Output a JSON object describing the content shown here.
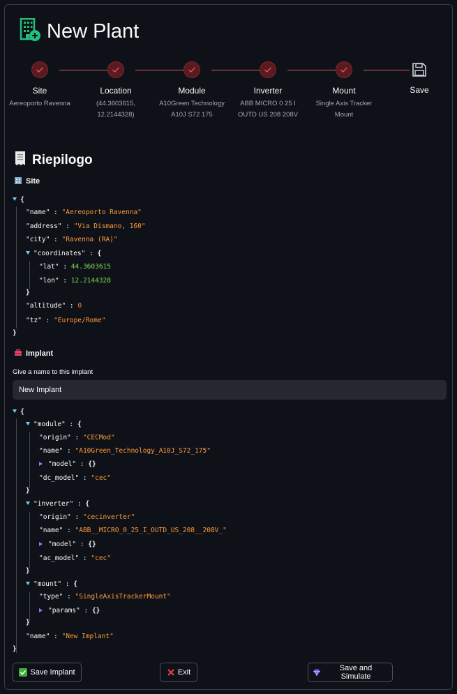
{
  "page": {
    "title": "New Plant",
    "title_icon": "building-plus-icon"
  },
  "stepper": {
    "steps": [
      {
        "label": "Site",
        "sub": "Aereoporto Ravenna",
        "state": "done"
      },
      {
        "label": "Location",
        "sub": "(44.3603615, 12.2144328)",
        "state": "done"
      },
      {
        "label": "Module",
        "sub": "A10Green Technology A10J S72 175",
        "state": "done"
      },
      {
        "label": "Inverter",
        "sub": "ABB MICRO 0 25 I OUTD US 208 208V",
        "state": "done"
      },
      {
        "label": "Mount",
        "sub": "Single Axis Tracker Mount",
        "state": "done"
      },
      {
        "label": "Save",
        "sub": "",
        "state": "current"
      }
    ],
    "done_color": "#e0555f"
  },
  "summary": {
    "heading": "Riepilogo",
    "heading_icon": "receipt-icon",
    "site_heading": "Site",
    "site_icon": "office-building-icon",
    "implant_heading": "Implant",
    "implant_icon": "toolbox-icon"
  },
  "site_json": {
    "name": "\"Aereoporto Ravenna\"",
    "address": "\"Via Dismano, 160\"",
    "city": "\"Ravenna (RA)\"",
    "lat": "44.3603615",
    "lon": "12.2144328",
    "altitude": "0",
    "tz": "\"Europe/Rome\""
  },
  "implant_input": {
    "label": "Give a name to this implant",
    "value": "New Implant"
  },
  "implant_json": {
    "module_origin": "\"CECMod\"",
    "module_name": "\"A10Green_Technology_A10J_S72_175\"",
    "module_dc_model": "\"cec\"",
    "inverter_origin": "\"cecinverter\"",
    "inverter_name": "\"ABB__MICRO_0_25_I_OUTD_US_208__208V_\"",
    "inverter_ac_model": "\"cec\"",
    "mount_type": "\"SingleAxisTrackerMount\"",
    "name": "\"New Implant\""
  },
  "keys": {
    "name": "\"name\"",
    "address": "\"address\"",
    "city": "\"city\"",
    "coordinates": "\"coordinates\"",
    "lat": "\"lat\"",
    "lon": "\"lon\"",
    "altitude": "\"altitude\"",
    "tz": "\"tz\"",
    "module": "\"module\"",
    "origin": "\"origin\"",
    "model": "\"model\"",
    "dc_model": "\"dc_model\"",
    "inverter": "\"inverter\"",
    "ac_model": "\"ac_model\"",
    "mount": "\"mount\"",
    "type": "\"type\"",
    "params": "\"params\""
  },
  "buttons": {
    "save_implant": "Save Implant",
    "exit": "Exit",
    "save_and_simulate": "Save and Simulate"
  }
}
